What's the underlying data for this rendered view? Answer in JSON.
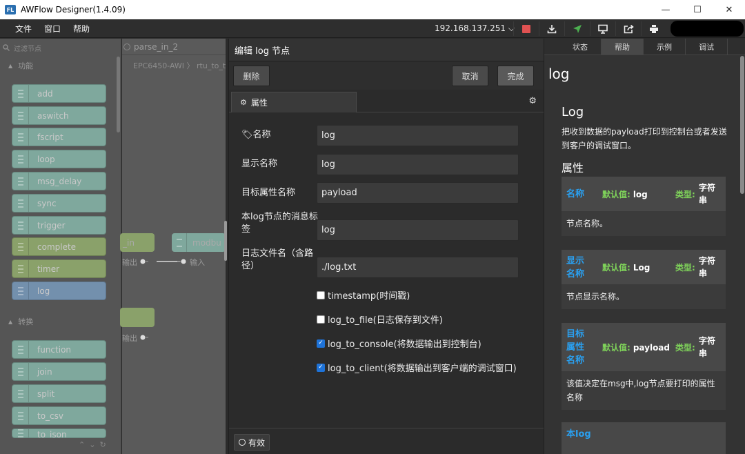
{
  "window": {
    "title": "AWFlow Designer(1.4.09)",
    "app_icon_text": "FL",
    "controls": [
      "—",
      "☐",
      "✕"
    ]
  },
  "menu": {
    "items": [
      "文件",
      "窗口",
      "帮助"
    ],
    "ip": "192.168.137.251 ⌵"
  },
  "toolbar": {
    "icons": [
      "stop-icon",
      "download-icon",
      "deploy-icon",
      "monitor-icon",
      "export-icon",
      "printer-icon"
    ],
    "colors": {
      "stop": "#e05252",
      "deploy": "#4caf50"
    }
  },
  "palette": {
    "search_placeholder": "过滤节点",
    "section_function": "功能",
    "section_transform": "转换",
    "function_nodes": [
      {
        "label": "add",
        "color": "#7fa89d"
      },
      {
        "label": "aswitch",
        "color": "#7fa89d"
      },
      {
        "label": "fscript",
        "color": "#7fa89d"
      },
      {
        "label": "loop",
        "color": "#7fa89d"
      },
      {
        "label": "msg_delay",
        "color": "#7fa89d"
      },
      {
        "label": "sync",
        "color": "#7fa89d"
      },
      {
        "label": "trigger",
        "color": "#7fa89d"
      },
      {
        "label": "complete",
        "color": "#8aa16a"
      },
      {
        "label": "timer",
        "color": "#8aa16a"
      },
      {
        "label": "log",
        "color": "#7390ad"
      }
    ],
    "transform_nodes": [
      {
        "label": "function",
        "color": "#7fa89d"
      },
      {
        "label": "join",
        "color": "#7fa89d"
      },
      {
        "label": "split",
        "color": "#7fa89d"
      },
      {
        "label": "to_csv",
        "color": "#7fa89d"
      },
      {
        "label": "to_json",
        "color": "#7fa89d"
      }
    ]
  },
  "canvas": {
    "tab": "parse_in_2",
    "breadcrumb": "EPC6450-AWI 〉 rtu_to_t",
    "node_in_label": "_in",
    "node_modbus_label": "modbu",
    "output_label": "输出",
    "input_label": "输入",
    "output_label2": "输出"
  },
  "editor": {
    "title": "编辑 log 节点",
    "delete": "删除",
    "cancel": "取消",
    "done": "完成",
    "tab_properties": "属性",
    "fields": [
      {
        "label": "名称",
        "value": "log"
      },
      {
        "label": "显示名称",
        "value": "log"
      },
      {
        "label": "目标属性名称",
        "value": "payload"
      },
      {
        "label": "本log节点的消息标签",
        "value": "log"
      },
      {
        "label": "日志文件名（含路径）",
        "value": "./log.txt"
      }
    ],
    "checkboxes": [
      {
        "label": "timestamp(时间戳)",
        "checked": false
      },
      {
        "label": "log_to_file(日志保存到文件)",
        "checked": false
      },
      {
        "label": "log_to_console(将数据输出到控制台)",
        "checked": true
      },
      {
        "label": "log_to_client(将数据输出到客户端的调试窗口)",
        "checked": true
      }
    ],
    "valid": "有效"
  },
  "sidebar": {
    "tabs": [
      "状态",
      "帮助",
      "示例",
      "调试"
    ],
    "active_tab": "帮助",
    "node_title": "log",
    "help_heading": "Log",
    "help_desc": "把收到数据的payload打印到控制台或者发送到客户的调试窗口。",
    "props_heading": "属性",
    "default_label": "默认值:",
    "type_label": "类型:",
    "properties": [
      {
        "name": "名称",
        "default": "log",
        "type": "字符串",
        "desc": "节点名称。"
      },
      {
        "name": "显示名称",
        "default": "Log",
        "type": "字符串",
        "desc": "节点显示名称。"
      },
      {
        "name": "目标属性名称",
        "default": "payload",
        "type": "字符串",
        "desc": "该值决定在msg中,log节点要打印的属性名称"
      },
      {
        "name": "本log",
        "default": "",
        "type": "",
        "desc": ""
      }
    ]
  }
}
